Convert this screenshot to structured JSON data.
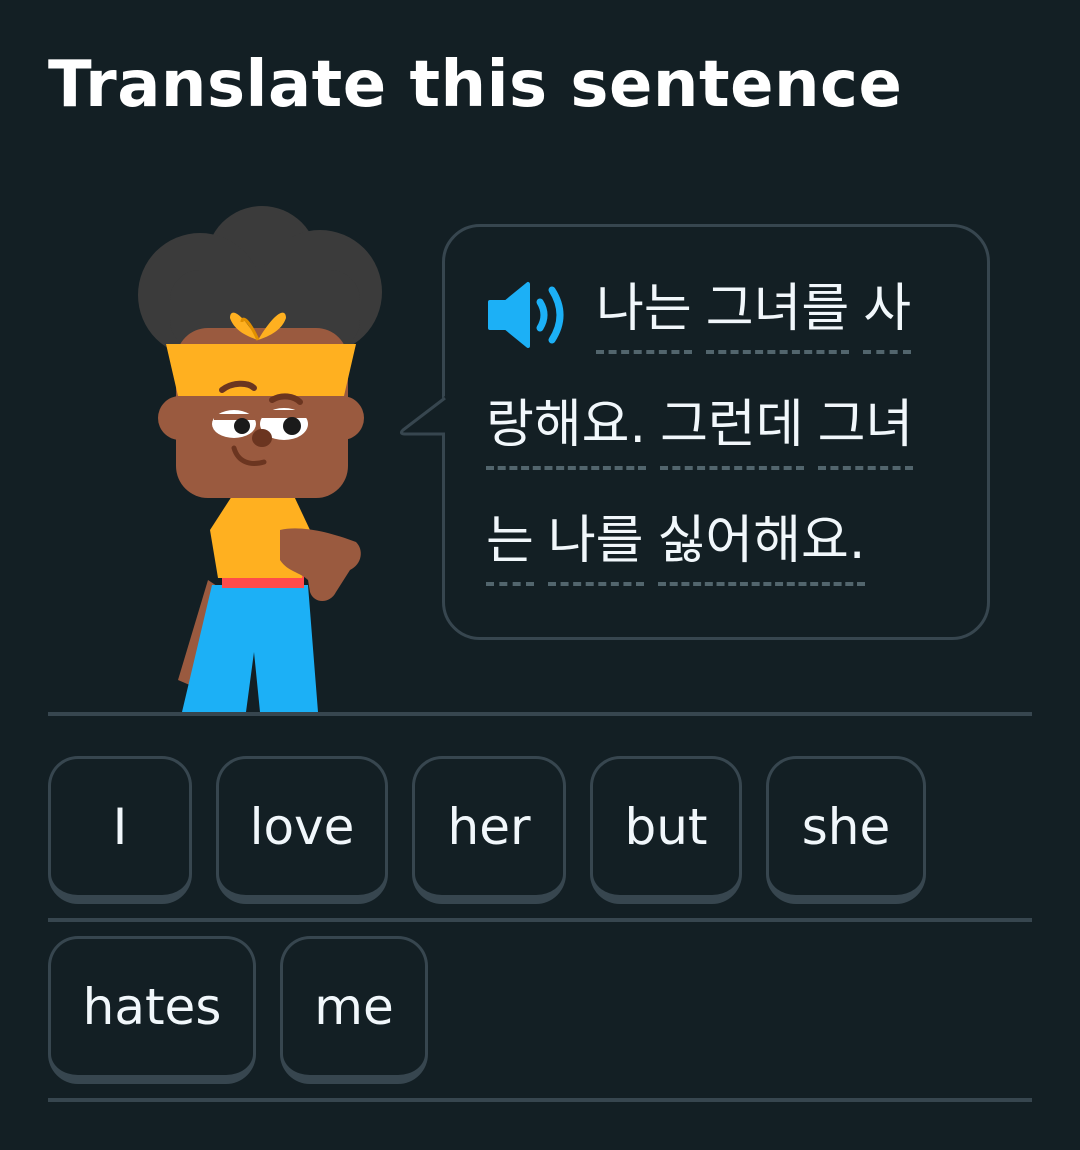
{
  "header": {
    "title": "Translate this sentence"
  },
  "prompt": {
    "speaker_icon": "speaker-icon",
    "lines": [
      [
        "나는",
        "그녀를",
        "사"
      ],
      [
        "랑해요.",
        "그런데",
        "그녀"
      ],
      [
        "는",
        "나를",
        "싫어해요."
      ]
    ]
  },
  "word_bank": {
    "row1": [
      "I",
      "love",
      "her",
      "but",
      "she"
    ],
    "row2": [
      "hates",
      "me"
    ]
  },
  "colors": {
    "background": "#131f24",
    "border": "#37464f",
    "accent": "#1cb0f6",
    "headband": "#ffb020"
  }
}
